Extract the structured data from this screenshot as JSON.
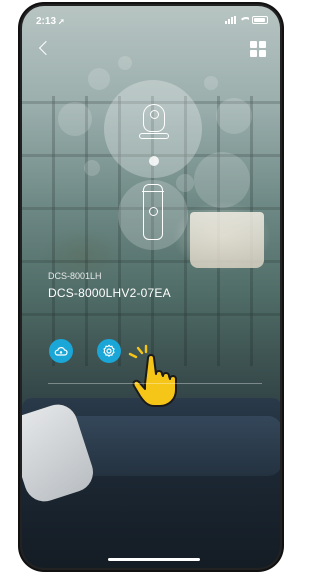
{
  "status_bar": {
    "time": "2:13",
    "location_arrow": "location-arrow-icon",
    "icons": [
      "signal-icon",
      "wifi-icon",
      "battery-icon"
    ]
  },
  "header": {
    "back_icon": "chevron-left-icon",
    "menu_icon": "grid-icon"
  },
  "devices": [
    {
      "icon": "round-camera-icon"
    },
    {
      "icon": "cylinder-camera-icon"
    }
  ],
  "device": {
    "model": "DCS-8001LH",
    "name": "DCS-8000LHV2-07EA"
  },
  "actions": [
    {
      "icon": "cloud-icon"
    },
    {
      "icon": "gear-icon"
    }
  ],
  "colors": {
    "accent": "#1aa7d8",
    "hand": "#f5c518"
  }
}
